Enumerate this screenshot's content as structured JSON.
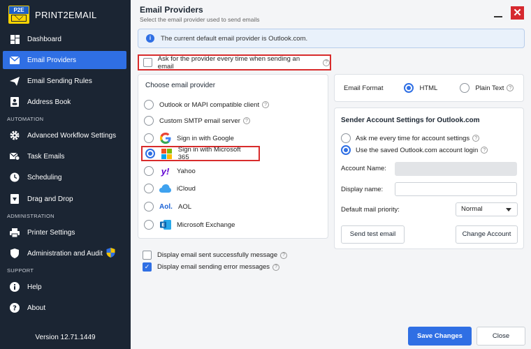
{
  "app": {
    "brand": "PRINT2EMAIL",
    "logo_text": "P2E",
    "version": "Version 12.71.1449"
  },
  "colors": {
    "sidebar_bg": "#1b2533",
    "accent": "#2f6fe4",
    "highlight_red": "#d82c2c",
    "close_red": "#d6292f"
  },
  "sidebar": {
    "items": [
      {
        "label": "Dashboard",
        "icon": "dashboard-icon",
        "active": false
      },
      {
        "label": "Email Providers",
        "icon": "envelope-icon",
        "active": true
      },
      {
        "label": "Email Sending Rules",
        "icon": "send-icon",
        "active": false
      },
      {
        "label": "Address Book",
        "icon": "address-book-icon",
        "active": false
      }
    ],
    "section_automation": "AUTOMATION",
    "automation_items": [
      {
        "label": "Advanced Workflow Settings",
        "icon": "gear-icon"
      },
      {
        "label": "Task Emails",
        "icon": "task-email-icon"
      },
      {
        "label": "Scheduling",
        "icon": "clock-icon"
      },
      {
        "label": "Drag and Drop",
        "icon": "drop-icon"
      }
    ],
    "section_administration": "ADMINISTRATION",
    "administration_items": [
      {
        "label": "Printer Settings",
        "icon": "printer-icon"
      },
      {
        "label": "Administration and Audit",
        "icon": "shield-icon"
      }
    ],
    "section_support": "SUPPORT",
    "support_items": [
      {
        "label": "Help",
        "icon": "info-icon"
      },
      {
        "label": "About",
        "icon": "question-icon"
      }
    ]
  },
  "header": {
    "title": "Email Providers",
    "subtitle": "Select the email provider used to send emails"
  },
  "info_banner": "The current default email provider is Outlook.com.",
  "ask_every_time": {
    "label": "Ask for the provider every time when sending an email",
    "checked": false
  },
  "providers": {
    "title": "Choose email provider",
    "items": [
      {
        "label": "Outlook or MAPI compatible client",
        "logo": "none",
        "help": true
      },
      {
        "label": "Custom SMTP email server",
        "logo": "none",
        "help": true
      },
      {
        "label": "Sign in with Google",
        "logo": "google-icon"
      },
      {
        "label": "Sign in with Microsoft 365",
        "logo": "microsoft-icon",
        "selected": true
      },
      {
        "label": "Yahoo",
        "logo": "yahoo-icon"
      },
      {
        "label": "iCloud",
        "logo": "icloud-icon"
      },
      {
        "label": "AOL",
        "logo": "aol-icon"
      },
      {
        "label": "Microsoft Exchange",
        "logo": "exchange-icon"
      }
    ],
    "yahoo_logo_text": "y!",
    "aol_logo_text": "Aol."
  },
  "email_format": {
    "label": "Email Format",
    "options": [
      "HTML",
      "Plain Text"
    ],
    "selected": "HTML"
  },
  "sender": {
    "title": "Sender Account Settings for Outlook.com",
    "radio_ask": "Ask me every time for account settings",
    "radio_saved": "Use the saved Outlook.com account login",
    "account_name_label": "Account Name:",
    "account_name_value": "",
    "display_name_label": "Display name:",
    "display_name_value": "",
    "priority_label": "Default mail priority:",
    "priority_value": "Normal",
    "send_test_label": "Send test email",
    "change_account_label": "Change Account"
  },
  "bottom_options": [
    {
      "label": "Display email sent successfully message",
      "checked": false
    },
    {
      "label": "Display email sending error messages",
      "checked": true
    }
  ],
  "footer": {
    "save_label": "Save Changes",
    "close_label": "Close"
  }
}
